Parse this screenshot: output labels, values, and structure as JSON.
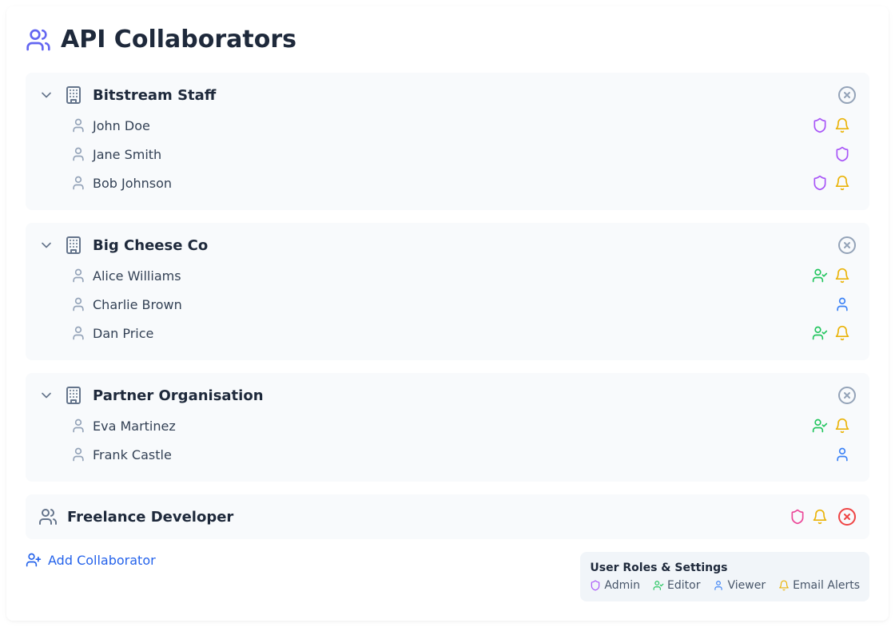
{
  "header": {
    "title": "API Collaborators"
  },
  "orgs": [
    {
      "name": "Bitstream Staff",
      "members": [
        {
          "name": "John Doe",
          "role": "admin",
          "alerts": true
        },
        {
          "name": "Jane Smith",
          "role": "admin",
          "alerts": false
        },
        {
          "name": "Bob Johnson",
          "role": "admin",
          "alerts": true
        }
      ]
    },
    {
      "name": "Big Cheese Co",
      "members": [
        {
          "name": "Alice Williams",
          "role": "editor",
          "alerts": true
        },
        {
          "name": "Charlie Brown",
          "role": "viewer",
          "alerts": false
        },
        {
          "name": "Dan Price",
          "role": "editor",
          "alerts": true
        }
      ]
    },
    {
      "name": "Partner Organisation",
      "members": [
        {
          "name": "Eva Martinez",
          "role": "editor",
          "alerts": true
        },
        {
          "name": "Frank Castle",
          "role": "viewer",
          "alerts": false
        }
      ]
    }
  ],
  "freelancer": {
    "name": "Freelance Developer",
    "role": "admin_pink",
    "alerts": true
  },
  "add_label": "Add Collaborator",
  "legend": {
    "title": "User Roles & Settings",
    "admin": "Admin",
    "editor": "Editor",
    "viewer": "Viewer",
    "alerts": "Email Alerts"
  }
}
